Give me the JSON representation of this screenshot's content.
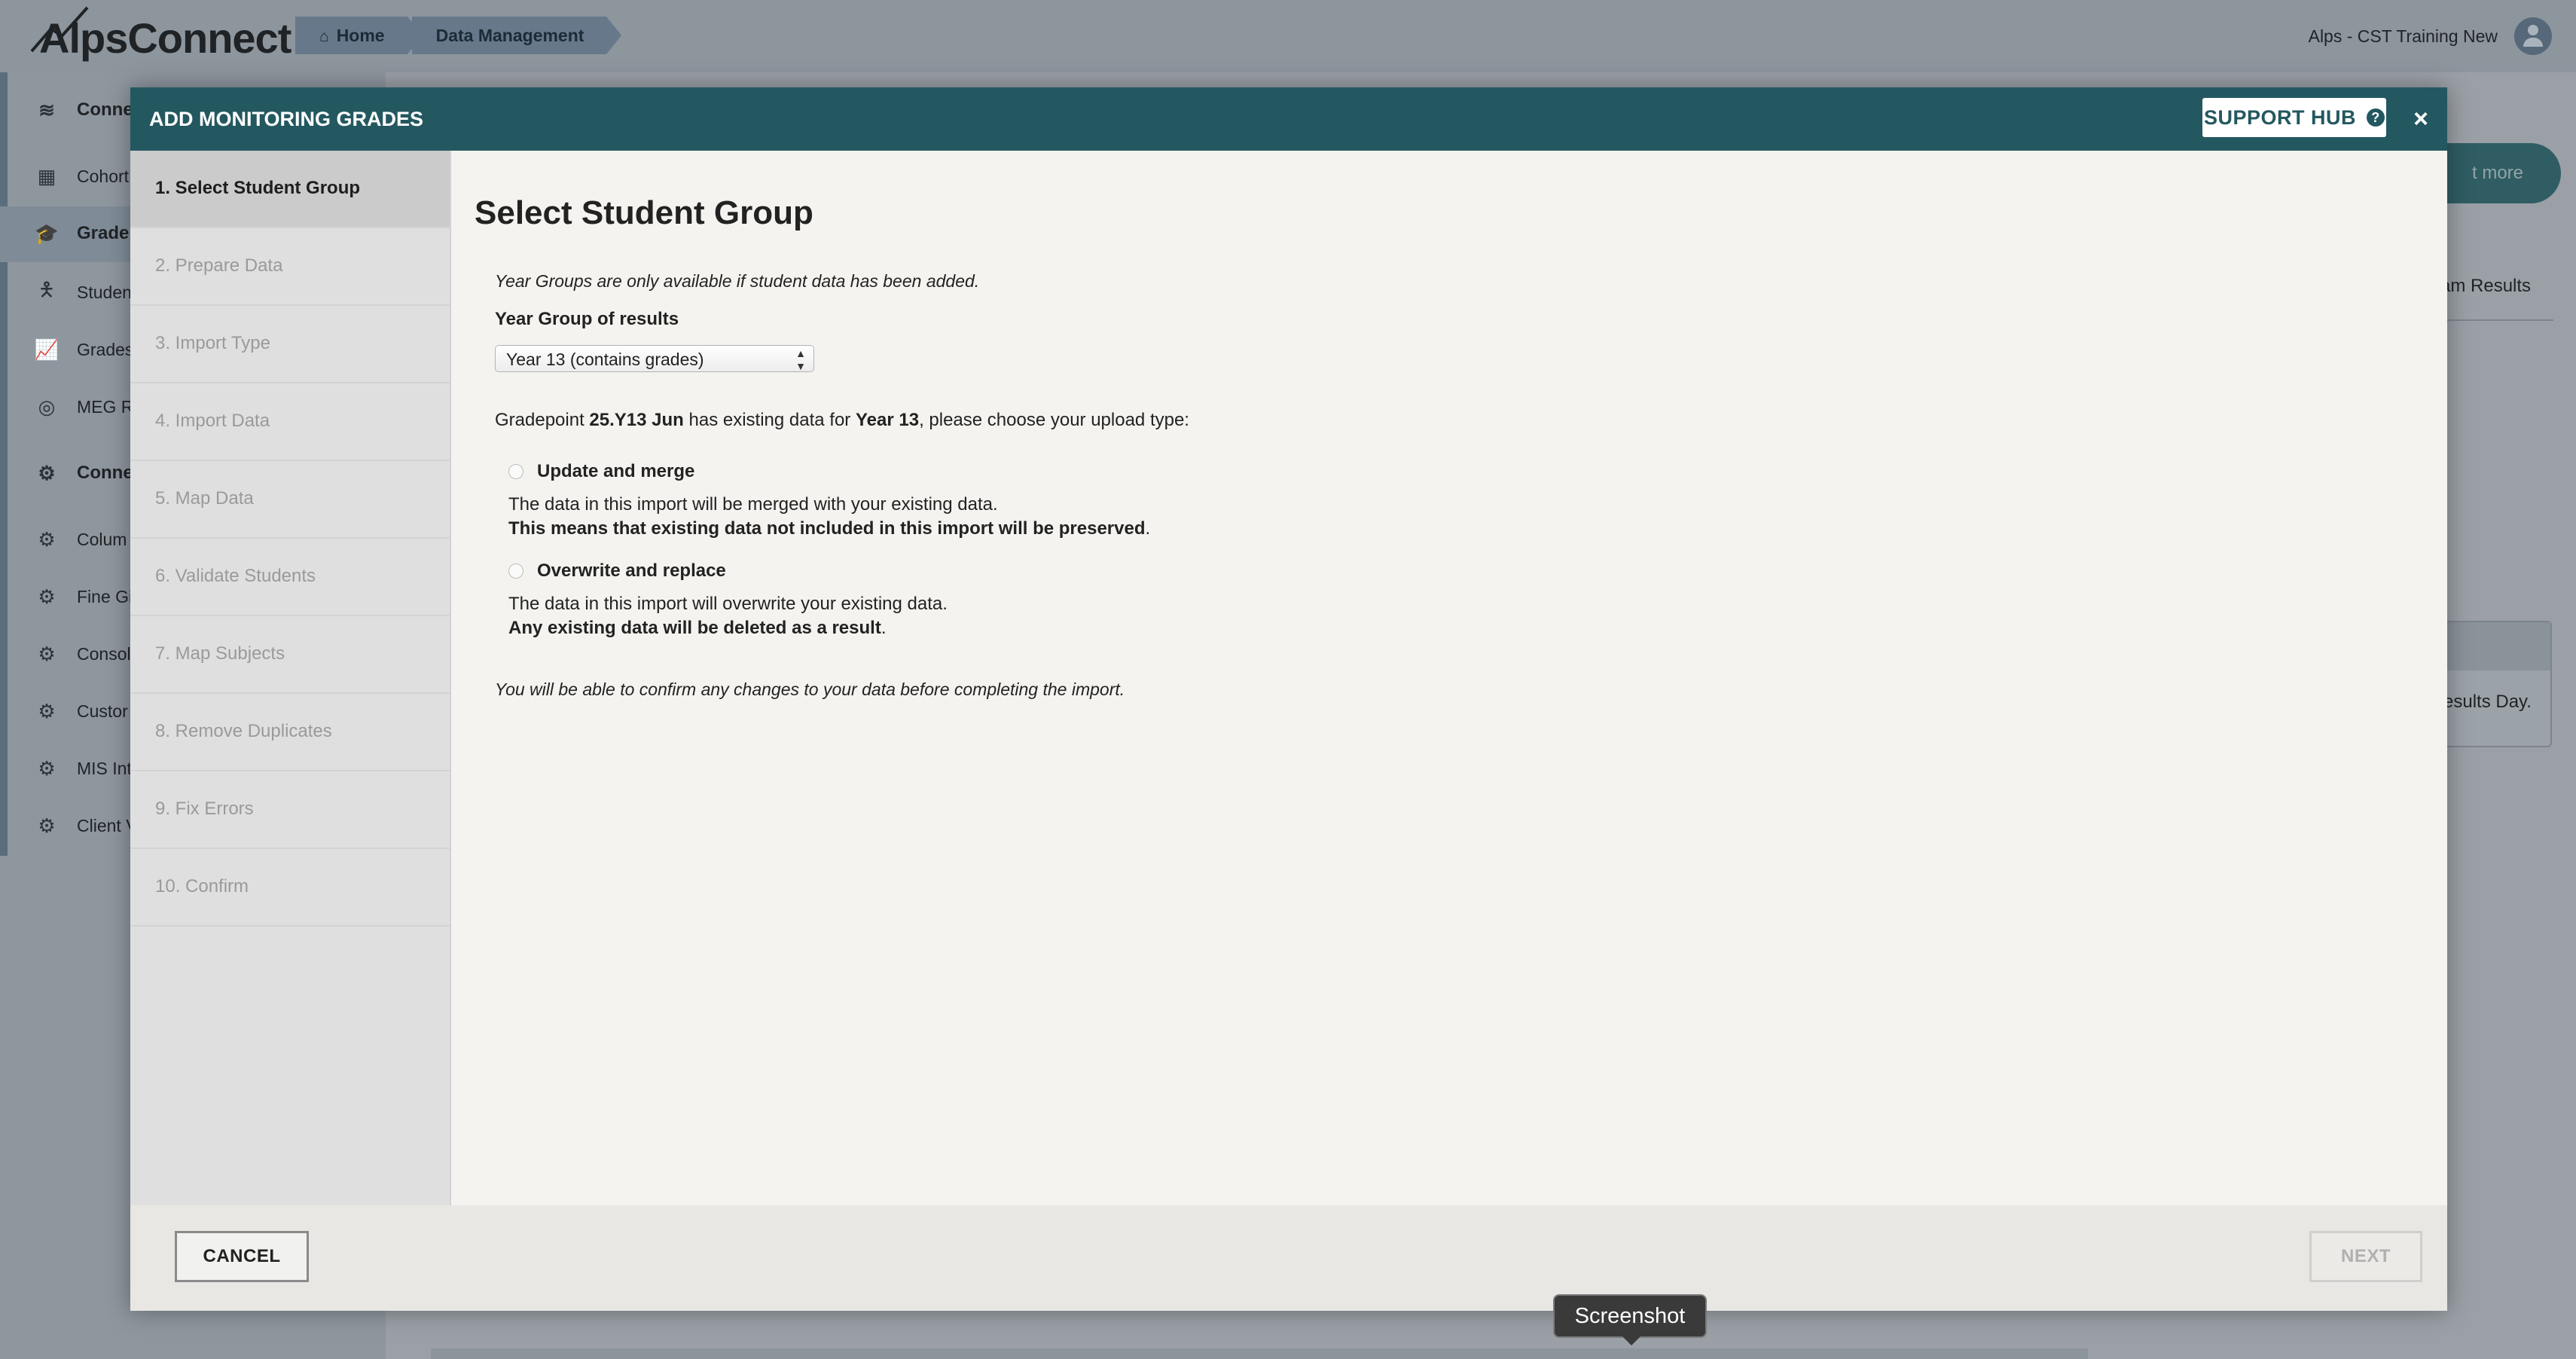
{
  "app": {
    "logo": "AlpsConnect",
    "breadcrumbs": [
      {
        "label": "Home",
        "icon": "home-icon"
      },
      {
        "label": "Data Management"
      }
    ],
    "user_name": "Alps - CST Training New"
  },
  "sidebar": {
    "sections": [
      {
        "label": "Conne",
        "icon": "database-icon",
        "items": [
          {
            "label": "Cohort",
            "icon": "table-icon"
          },
          {
            "label": "Grade",
            "icon": "graduation-cap-icon",
            "active": true
          },
          {
            "label": "Studen",
            "icon": "student-icon"
          },
          {
            "label": "Grades",
            "icon": "line-chart-icon"
          },
          {
            "label": "MEG R",
            "icon": "target-icon"
          }
        ]
      },
      {
        "label": "Conne",
        "icon": "gear-icon",
        "items": [
          {
            "label": "Colum",
            "icon": "gear-icon"
          },
          {
            "label": "Fine Gi",
            "icon": "gear-icon"
          },
          {
            "label": "Consol",
            "icon": "gear-icon"
          },
          {
            "label": "Custor",
            "icon": "gear-icon"
          },
          {
            "label": "MIS Int",
            "icon": "gear-icon"
          },
          {
            "label": "Client V",
            "icon": "gear-icon"
          }
        ]
      }
    ]
  },
  "background": {
    "card_button": "t more",
    "tab_label": "am Results",
    "box_text": "esults Day."
  },
  "modal": {
    "title": "ADD MONITORING GRADES",
    "support_label": "SUPPORT HUB",
    "close_label": "×",
    "steps": [
      "1. Select Student Group",
      "2. Prepare Data",
      "3. Import Type",
      "4. Import Data",
      "5. Map Data",
      "6. Validate Students",
      "7. Map Subjects",
      "8. Remove Duplicates",
      "9. Fix Errors",
      "10. Confirm"
    ],
    "active_step": 0,
    "heading": "Select Student Group",
    "year_note": "Year Groups are only available if student data has been added.",
    "year_label": "Year Group of results",
    "year_selected": "Year 13 (contains grades)",
    "gradepoint_text": {
      "prefix": "Gradepoint ",
      "gradepoint": "25.Y13 Jun",
      "middle": " has existing data for ",
      "year": "Year 13",
      "suffix": ", please choose your upload type:"
    },
    "options": [
      {
        "label": "Update and merge",
        "line1": "The data in this import will be merged with your existing data.",
        "line2_bold": "This means that existing data not included in this import will be preserved",
        "line2_end": "."
      },
      {
        "label": "Overwrite and replace",
        "line1": "The data in this import will overwrite your existing data.",
        "line2_bold": "Any existing data will be deleted as a result",
        "line2_end": "."
      }
    ],
    "confirm_note": "You will be able to confirm any changes to your data before completing the import.",
    "cancel_label": "CANCEL",
    "next_label": "NEXT"
  },
  "tooltip": "Screenshot",
  "colors": {
    "header_teal": "#245860",
    "overlay_gray": "#9aa1a8"
  }
}
